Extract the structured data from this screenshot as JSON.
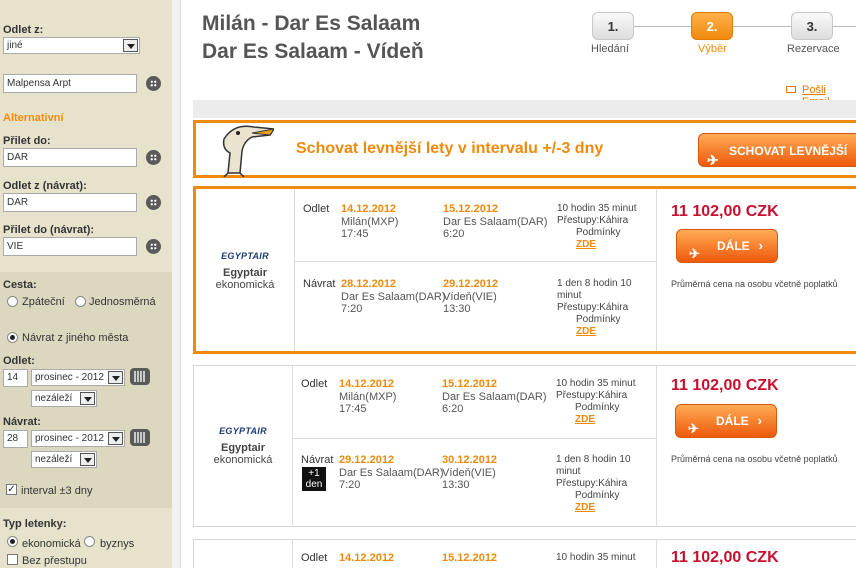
{
  "sidebar": {
    "odlet_z_label": "Odlet z:",
    "odlet_z_select": "jiné",
    "odlet_z_airport": "Malpensa Arpt",
    "alternativni": "Alternativní",
    "prilet_do_label": "Přilet do:",
    "prilet_do_value": "DAR",
    "odlet_navrat_label": "Odlet z (návrat):",
    "odlet_navrat_value": "DAR",
    "prilet_navrat_label": "Přilet do (návrat):",
    "prilet_navrat_value": "VIE",
    "cesta_label": "Cesta:",
    "zpatecni": "Zpáteční",
    "jednosmerna": "Jednosměrná",
    "navrat_jineho": "Návrat z jiného města",
    "odlet_label": "Odlet:",
    "odlet_day": "14",
    "odlet_month": "prosinec - 2012",
    "odlet_time": "nezáleží",
    "navrat_label": "Návrat:",
    "navrat_day": "28",
    "navrat_month": "prosinec - 2012",
    "navrat_time": "nezáleží",
    "interval": "interval ±3 dny",
    "typ_label": "Typ letenky:",
    "ekonomicka": "ekonomická",
    "byznys": "byznys",
    "bez_prestupu": "Bez přestupu"
  },
  "header": {
    "route_out": "Milán - Dar Es Salaam",
    "route_back": "Dar Es Salaam - Vídeň",
    "steps": [
      {
        "num": "1.",
        "label": "Hledání"
      },
      {
        "num": "2.",
        "label": "Výběr"
      },
      {
        "num": "3.",
        "label": "Rezervace"
      }
    ],
    "email_link": "Pošli Email"
  },
  "promo": {
    "text": "Schovat levnější lety v intervalu +/-3 dny",
    "button": "SCHOVAT LEVNĚJŠÍ LETY"
  },
  "flights": [
    {
      "airline_logo": "EGYPTAIR",
      "airline": "Egyptair",
      "class": "ekonomická",
      "out": {
        "dir": "Odlet",
        "dep_date": "14.12.2012",
        "dep_place": "Milán(MXP)",
        "dep_time": "17:45",
        "arr_date": "15.12.2012",
        "arr_place": "Dar Es Salaam(DAR)",
        "arr_time": "6:20",
        "duration": "10 hodin 35 minut",
        "transfer": "Přestupy:Káhira",
        "conditions": "Podmínky",
        "zde": "ZDE"
      },
      "back": {
        "dir": "Návrat",
        "dep_date": "28.12.2012",
        "dep_place": "Dar Es Salaam(DAR)",
        "dep_time": "7:20",
        "arr_date": "29.12.2012",
        "arr_place": "Vídeň(VIE)",
        "arr_time": "13:30",
        "duration1": "1 den 8 hodin 10",
        "duration2": "minut",
        "transfer": "Přestupy:Káhira",
        "conditions": "Podmínky",
        "zde": "ZDE"
      },
      "price": "11 102,00 CZK",
      "button": "DÁLE",
      "avg": "Průměrná cena na osobu včetně poplatků"
    },
    {
      "airline_logo": "EGYPTAIR",
      "airline": "Egyptair",
      "class": "ekonomická",
      "out": {
        "dir": "Odlet",
        "dep_date": "14.12.2012",
        "dep_place": "Milán(MXP)",
        "dep_time": "17:45",
        "arr_date": "15.12.2012",
        "arr_place": "Dar Es Salaam(DAR)",
        "arr_time": "6:20",
        "duration": "10 hodin 35 minut",
        "transfer": "Přestupy:Káhira",
        "conditions": "Podmínky",
        "zde": "ZDE"
      },
      "back": {
        "dir": "Návrat",
        "plus1_a": "+1",
        "plus1_b": "den",
        "dep_date": "29.12.2012",
        "dep_place": "Dar Es Salaam(DAR)",
        "dep_time": "7:20",
        "arr_date": "30.12.2012",
        "arr_place": "Vídeň(VIE)",
        "arr_time": "13:30",
        "duration1": "1 den 8 hodin 10",
        "duration2": "minut",
        "transfer": "Přestupy:Káhira",
        "conditions": "Podmínky",
        "zde": "ZDE"
      },
      "price": "11 102,00 CZK",
      "button": "DÁLE",
      "avg": "Průměrná cena na osobu včetně poplatků"
    },
    {
      "out": {
        "dir": "Odlet",
        "dep_date": "14.12.2012",
        "arr_date": "15.12.2012",
        "duration": "10 hodin 35 minut"
      },
      "price": "11 102,00 CZK"
    }
  ]
}
